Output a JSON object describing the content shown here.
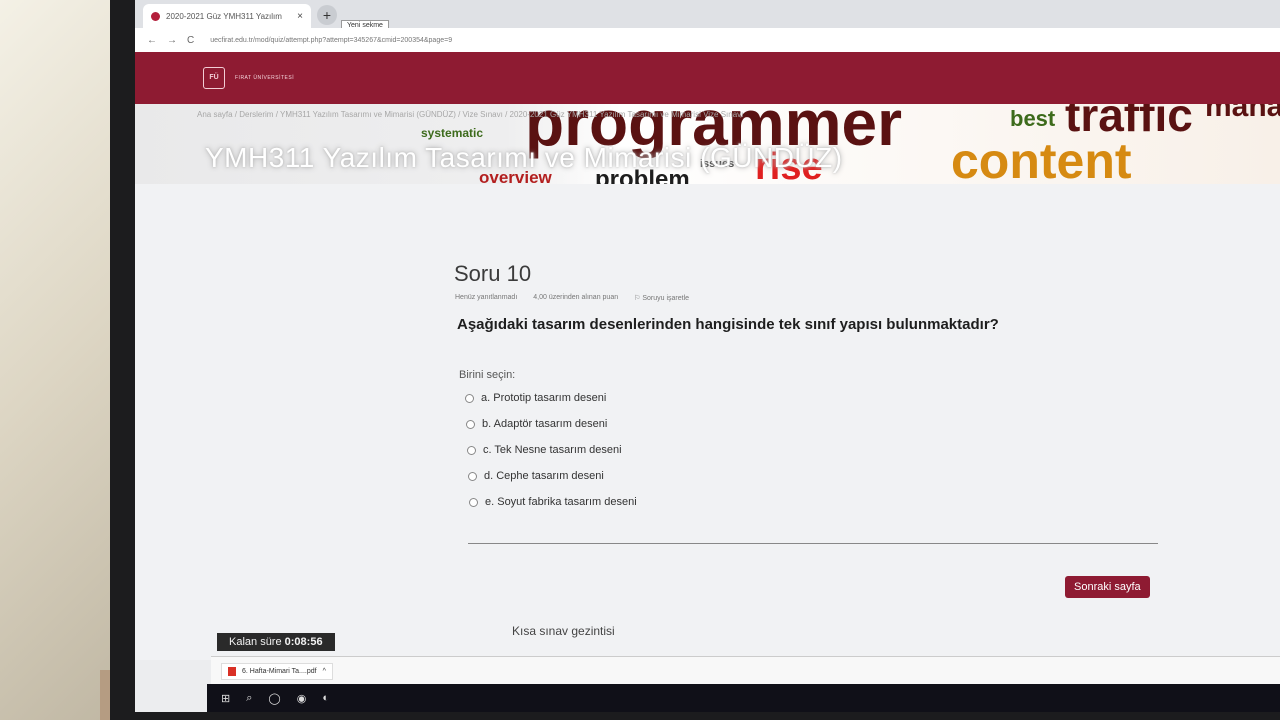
{
  "browser": {
    "tab_title": "2020-2021 Güz YMH311 Yazılım",
    "tab_close": "×",
    "new_tab": "+",
    "tooltip": "Yeni sekme",
    "back": "←",
    "forward": "→",
    "reload": "C",
    "url": "uecfirat.edu.tr/mod/quiz/attempt.php?attempt=345267&cmid=200354&page=9"
  },
  "site": {
    "logo": "FÜ",
    "university": "FIRAT ÜNİVERSİTESİ"
  },
  "banner": {
    "breadcrumb": "Ana sayfa / Derslerim / YMH311 Yazılım Tasarımı ve Mimarisi (GÜNDÜZ) / Vize Sınavı / 2020-2021 Güz YMH311 Yazılım Tasarımı ve Mimarisi Vize Sınavı",
    "course_title": "YMH311 Yazılım Tasarımı ve Mimarisi (GÜNDÜZ)",
    "words": [
      "programmer",
      "traffic",
      "managem",
      "best",
      "content",
      "systematic",
      "overview",
      "problem",
      "issues",
      "rise"
    ]
  },
  "question": {
    "title": "Soru 10",
    "status": "Henüz yanıtlanmadı",
    "points": "4,00 üzerinden alınan puan",
    "flag": "Soruyu işaretle",
    "text": "Aşağıdaki tasarım desenlerinden hangisinde tek sınıf yapısı bulunmaktadır?",
    "prompt": "Birini seçin:",
    "options": [
      "a. Prototip tasarım deseni",
      "b. Adaptör tasarım deseni",
      "c. Tek Nesne tasarım deseni",
      "d. Cephe tasarım deseni",
      "e. Soyut fabrika tasarım deseni"
    ]
  },
  "actions": {
    "next": "Sonraki sayfa",
    "quiz_nav": "Kısa sınav gezintisi"
  },
  "timer": {
    "label": "Kalan süre ",
    "value": "0:08:56"
  },
  "downloads": {
    "file": "6. Hafta-Mimari Ta....pdf",
    "chevron": "^"
  },
  "taskbar": {
    "items": [
      "⊞",
      "⌕",
      "◯",
      "◉",
      "◐"
    ]
  },
  "colors": {
    "brand": "#8e1b32",
    "timer_bg": "#2a2a2a"
  }
}
